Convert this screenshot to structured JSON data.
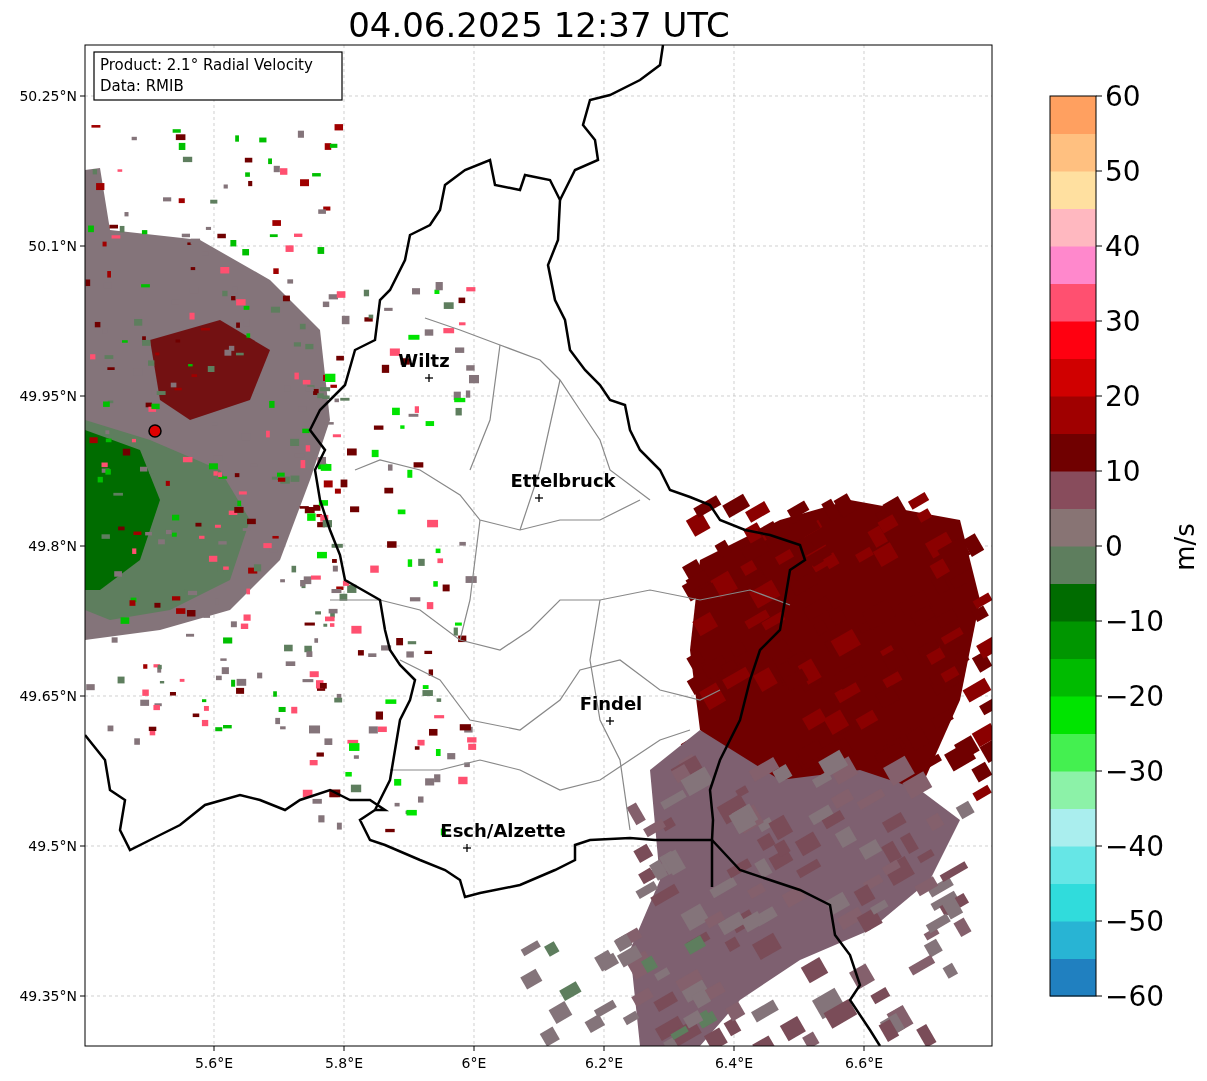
{
  "title": "04.06.2025 12:37 UTC",
  "info_box": [
    "Product: 2.1° Radial Velocity",
    "Data: RMIB"
  ],
  "map": {
    "x_ticks": [
      "5.6°E",
      "5.8°E",
      "6°E",
      "6.2°E",
      "6.4°E",
      "6.6°E"
    ],
    "y_ticks": [
      "50.25°N",
      "50.1°N",
      "49.95°N",
      "49.8°N",
      "49.65°N",
      "49.5°N",
      "49.35°N"
    ],
    "cities": [
      {
        "name": "Wiltz"
      },
      {
        "name": "Ettelbruck"
      },
      {
        "name": "Findel"
      },
      {
        "name": "Esch/Alzette"
      }
    ]
  },
  "colorbar": {
    "label": "m/s",
    "ticks": [
      "60",
      "50",
      "40",
      "30",
      "20",
      "10",
      "0",
      "−10",
      "−20",
      "−30",
      "−40",
      "−50",
      "−60"
    ]
  }
}
